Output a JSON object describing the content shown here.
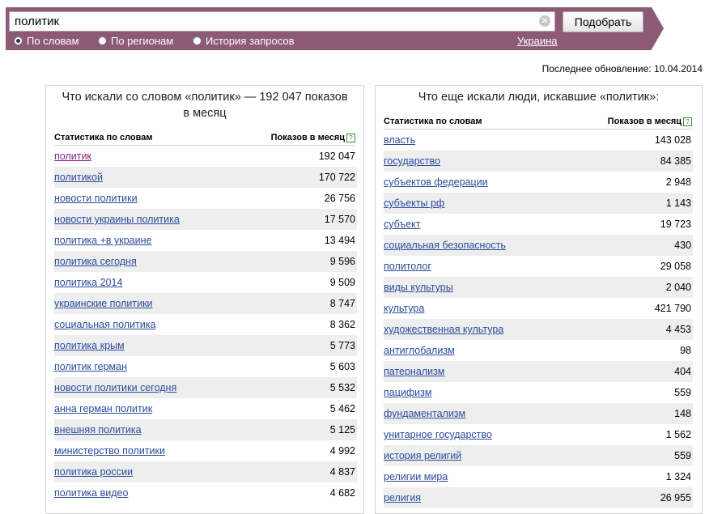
{
  "search": {
    "query": "политик",
    "button_label": "Подобрать"
  },
  "modes": [
    {
      "label": "По словам",
      "selected": true
    },
    {
      "label": "По регионам",
      "selected": false
    },
    {
      "label": "История запросов",
      "selected": false
    }
  ],
  "region": "Украина",
  "updated": "Последнее обновление: 10.04.2014",
  "left": {
    "title_line1": "Что искали со словом «политик» — 192 047 показов",
    "title_line2": "в месяц",
    "col_words": "Статистика по словам",
    "col_shows": "Показов в месяц",
    "rows": [
      [
        "политик",
        "192 047"
      ],
      [
        "политикой",
        "170 722"
      ],
      [
        "новости политики",
        "26 756"
      ],
      [
        "новости украины политика",
        "17 570"
      ],
      [
        "политика +в украине",
        "13 494"
      ],
      [
        "политика сегодня",
        "9 596"
      ],
      [
        "политика 2014",
        "9 509"
      ],
      [
        "украинские политики",
        "8 747"
      ],
      [
        "социальная политика",
        "8 362"
      ],
      [
        "политика крым",
        "5 773"
      ],
      [
        "политик герман",
        "5 603"
      ],
      [
        "новости политики сегодня",
        "5 532"
      ],
      [
        "анна герман политик",
        "5 462"
      ],
      [
        "внешняя политика",
        "5 125"
      ],
      [
        "министерство политики",
        "4 992"
      ],
      [
        "политика россии",
        "4 837"
      ],
      [
        "политика видео",
        "4 682"
      ]
    ]
  },
  "right": {
    "title": "Что еще искали люди, искавшие «политик»:",
    "col_words": "Статистика по словам",
    "col_shows": "Показов в месяц",
    "rows": [
      [
        "власть",
        "143 028"
      ],
      [
        "государство",
        "84 385"
      ],
      [
        "субъектов федерации",
        "2 948"
      ],
      [
        "субъекты рф",
        "1 143"
      ],
      [
        "субъект",
        "19 723"
      ],
      [
        "социальная безопасность",
        "430"
      ],
      [
        "политолог",
        "29 058"
      ],
      [
        "виды культуры",
        "2 040"
      ],
      [
        "культура",
        "421 790"
      ],
      [
        "художественная культура",
        "4 453"
      ],
      [
        "антиглобализм",
        "98"
      ],
      [
        "патернализм",
        "404"
      ],
      [
        "пацифизм",
        "559"
      ],
      [
        "фундаментализм",
        "148"
      ],
      [
        "унитарное государство",
        "1 562"
      ],
      [
        "история религий",
        "559"
      ],
      [
        "религии мира",
        "1 324"
      ],
      [
        "религия",
        "26 955"
      ]
    ]
  }
}
